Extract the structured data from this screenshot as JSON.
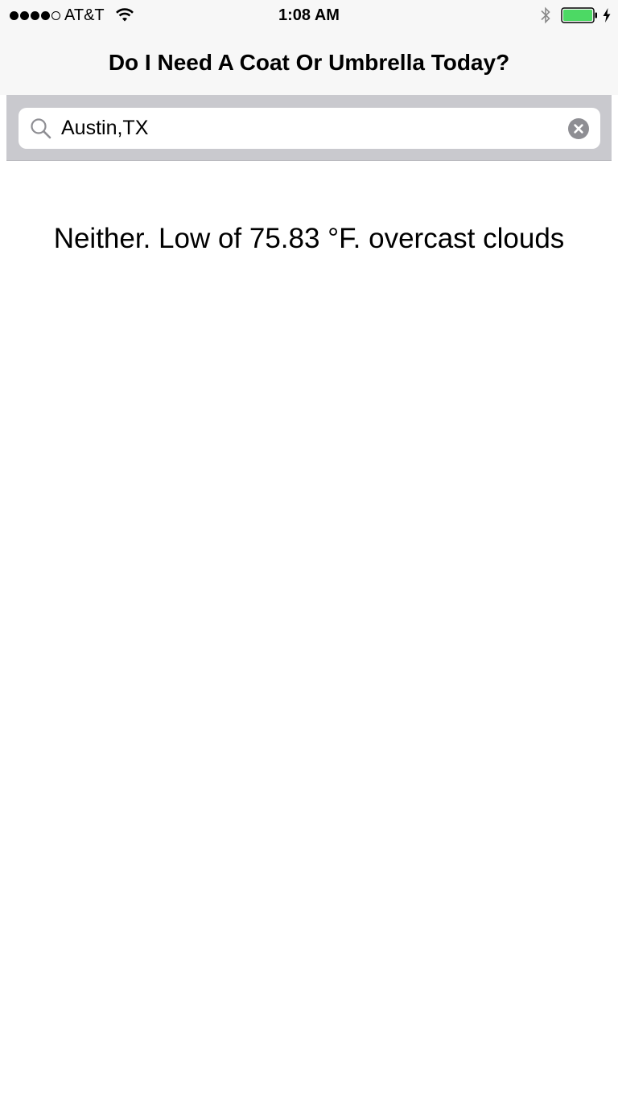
{
  "status_bar": {
    "signal_bars_filled": 4,
    "signal_bars_total": 5,
    "carrier": "AT&T",
    "wifi_icon": "wifi-icon",
    "time": "1:08 AM",
    "bluetooth_icon": "bluetooth-icon",
    "battery_level": 1.0,
    "battery_color": "#4cd964",
    "charging_icon": "charging-bolt-icon"
  },
  "nav": {
    "title": "Do I Need A Coat Or Umbrella Today?"
  },
  "search": {
    "value": "Austin,TX",
    "search_icon": "search-icon",
    "clear_icon": "clear-icon"
  },
  "result": {
    "text": "Neither. Low of 75.83 °F. overcast clouds"
  },
  "colors": {
    "bar_background": "#f7f7f7",
    "search_bar_background": "#c9c9ce",
    "clear_icon": "#8e8e93"
  }
}
